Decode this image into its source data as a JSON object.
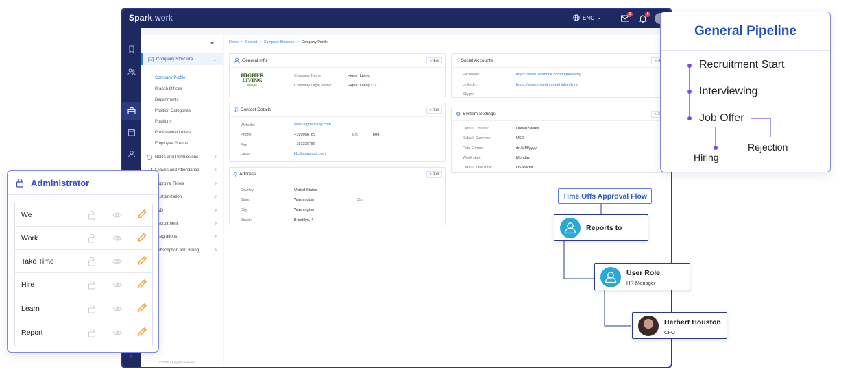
{
  "app": {
    "brand": "Spark",
    "brand_suffix": ".work",
    "language": "ENG",
    "mail_badge": "3",
    "bell_badge": "5"
  },
  "sidebar": {
    "items": [
      {
        "label": "Company Structure"
      },
      {
        "label": "Roles and Permissions"
      },
      {
        "label": "Leaves and Attendance"
      },
      {
        "label": "Approval Flows"
      },
      {
        "label": "Customization"
      },
      {
        "label": "L&D"
      },
      {
        "label": "Recruitment"
      },
      {
        "label": "Integrations"
      },
      {
        "label": "Subscription and Billing"
      }
    ],
    "subitems": [
      "Company Profile",
      "Branch Offices",
      "Departments",
      "Position Categories",
      "Positions",
      "Professional Levels",
      "Employee Groups"
    ],
    "footer": "© 2019 All rights reserved."
  },
  "breadcrumb": {
    "items": [
      "Home",
      "Cockpit",
      "Company Structure"
    ],
    "current": "Company Profile",
    "separator": ">"
  },
  "general_info": {
    "title": "General Info",
    "edit": "Edit",
    "logo_line1": "HIGHER",
    "logo_line2": "LIVING",
    "logo_tag": "ORGANIC",
    "company_name_label": "Company Name:",
    "company_name": "Higher Living",
    "legal_name_label": "Company Legal Name:",
    "legal_name": "Higher Living  LLC"
  },
  "contact": {
    "title": "Contact Details",
    "edit": "Edit",
    "website_label": "Website:",
    "website": "www.higherliving.com",
    "phone_label": "Phone:",
    "phone": "+199956789",
    "ext_label": "Ext:",
    "ext": "604",
    "fax_label": "Fax:",
    "fax": "+193336789",
    "email_label": "Email:",
    "email": "HL@corpmail.com"
  },
  "address": {
    "title": "Address",
    "edit": "Edit",
    "country_label": "Country:",
    "country": "United States",
    "state_label": "State:",
    "state": "Washington",
    "zip_label": "Zip:",
    "city_label": "City:",
    "city": "Washington",
    "street_label": "Street:",
    "street": "Brooklyn, 4"
  },
  "social": {
    "title": "Social Accounts",
    "edit": "Edit",
    "facebook_label": "Facebook:",
    "facebook": "https://www.facebook.com/higherliving",
    "linkedin_label": "LinkedIn:",
    "linkedin": "https://www.linkedin.com/higherliving",
    "skype_label": "Skype:"
  },
  "system": {
    "title": "System Settings",
    "edit": "Edit",
    "country_label": "Default Country:",
    "country": "United States",
    "currency_label": "Default Currency:",
    "currency": "USD",
    "date_label": "Date Format:",
    "date": "dd/MM/yyyy",
    "week_label": "Week start:",
    "week": "Monday",
    "tz_label": "Default Timezone:",
    "tz": "US/Pacific"
  },
  "admin": {
    "title": "Administrator",
    "rows": [
      "We",
      "Work",
      "Take Time",
      "Hire",
      "Learn",
      "Report"
    ]
  },
  "pipeline": {
    "title": "General Pipeline",
    "steps": [
      "Recruitment Start",
      "Interviewing",
      "Job Offer"
    ],
    "outcomes": [
      "Hiring",
      "Rejection"
    ]
  },
  "flow": {
    "title": "Time Offs Approval Flow",
    "reports_to": "Reports to",
    "user_role_title": "User Role",
    "user_role_sub": "HR Manager",
    "person_name": "Herbert Houston",
    "person_role": "CFO"
  },
  "colors": {
    "navy": "#1f2961",
    "accent": "#3f49cf",
    "link": "#2e7dd6",
    "edit_orange": "#f0a02a",
    "avatar_teal": "#2aa8d8",
    "pipeline_dot": "#7a4be0"
  }
}
